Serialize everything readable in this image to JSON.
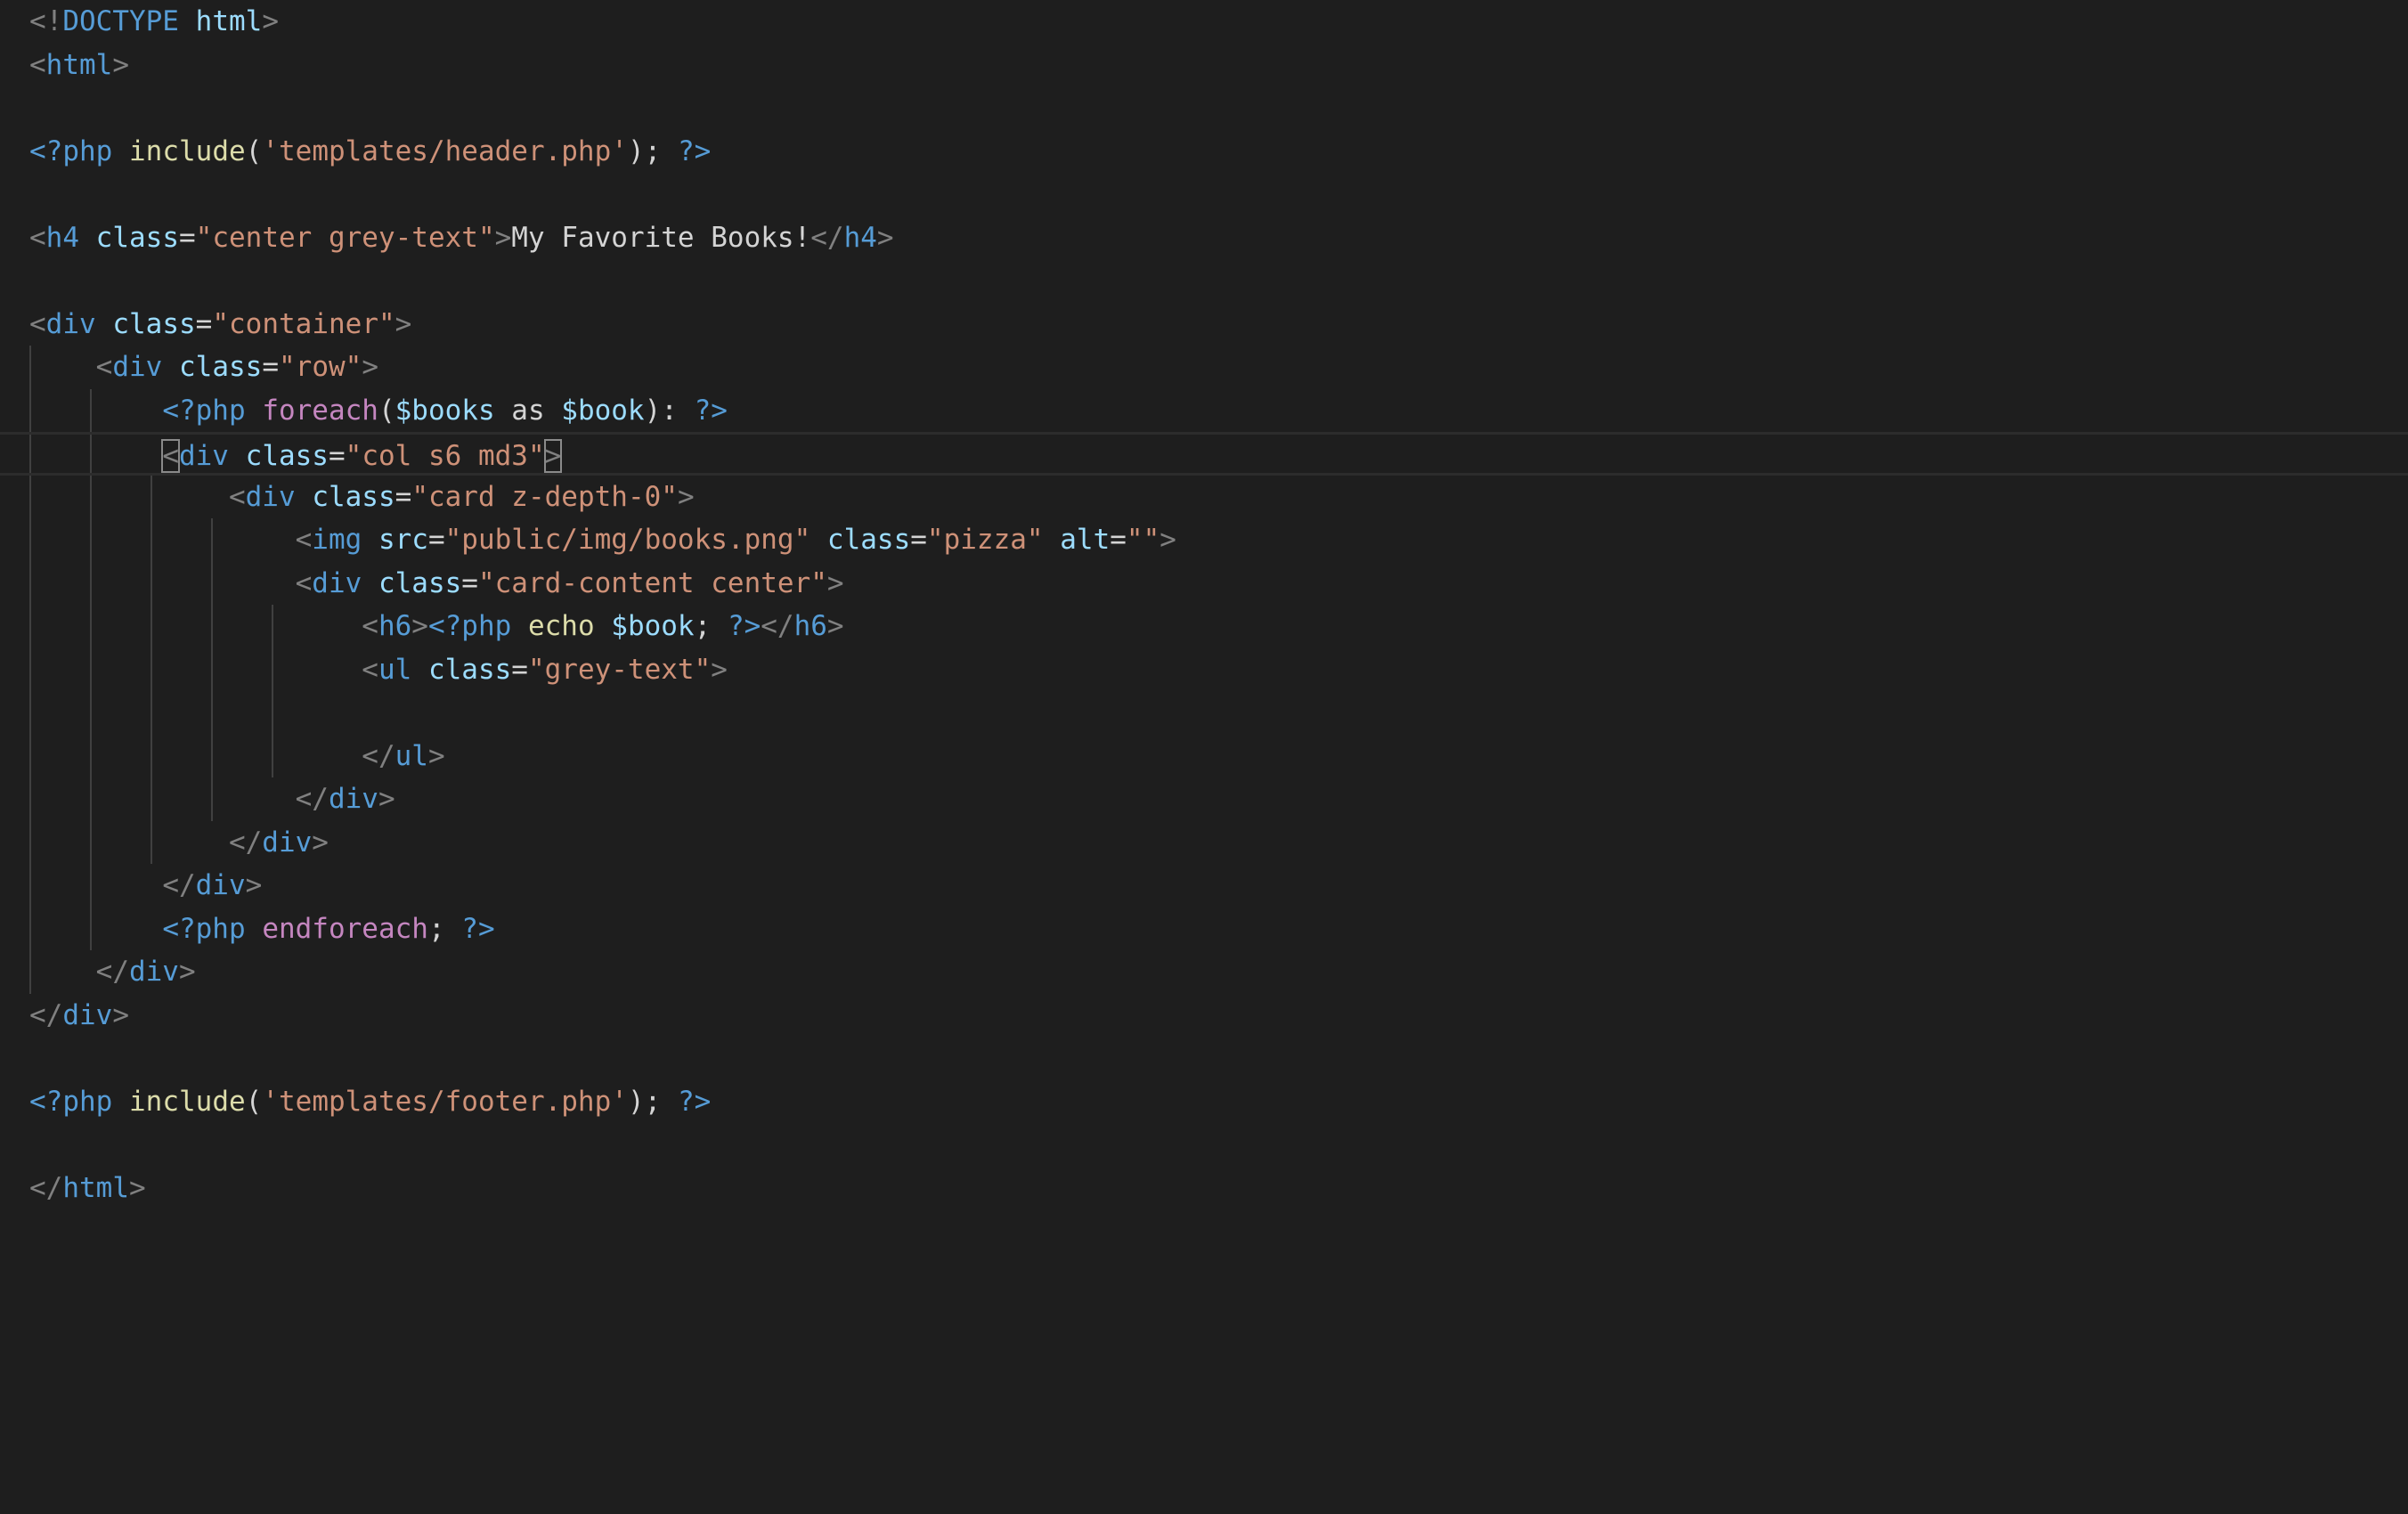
{
  "colors": {
    "background": "#1e1e1e",
    "punct": "#808080",
    "tag": "#569cd6",
    "attr": "#9cdcfe",
    "string": "#ce9178",
    "text": "#d4d4d4",
    "func": "#dcdcaa",
    "control": "#c586c0",
    "var": "#9cdcfe"
  },
  "current_line": 10,
  "lines": [
    {
      "indent": 0,
      "tokens": [
        {
          "t": "<!",
          "c": "punct"
        },
        {
          "t": "DOCTYPE",
          "c": "tag"
        },
        {
          "t": " ",
          "c": "text"
        },
        {
          "t": "html",
          "c": "attr"
        },
        {
          "t": ">",
          "c": "punct"
        }
      ]
    },
    {
      "indent": 0,
      "tokens": [
        {
          "t": "<",
          "c": "punct"
        },
        {
          "t": "html",
          "c": "tag"
        },
        {
          "t": ">",
          "c": "punct"
        }
      ]
    },
    {
      "indent": 0,
      "tokens": []
    },
    {
      "indent": 0,
      "tokens": [
        {
          "t": "<?php",
          "c": "tag"
        },
        {
          "t": " ",
          "c": "text"
        },
        {
          "t": "include",
          "c": "func"
        },
        {
          "t": "(",
          "c": "text"
        },
        {
          "t": "'templates/header.php'",
          "c": "string"
        },
        {
          "t": "); ",
          "c": "text"
        },
        {
          "t": "?>",
          "c": "tag"
        }
      ]
    },
    {
      "indent": 0,
      "tokens": []
    },
    {
      "indent": 0,
      "tokens": [
        {
          "t": "<",
          "c": "punct"
        },
        {
          "t": "h4",
          "c": "tag"
        },
        {
          "t": " ",
          "c": "text"
        },
        {
          "t": "class",
          "c": "attr"
        },
        {
          "t": "=",
          "c": "text"
        },
        {
          "t": "\"center grey-text\"",
          "c": "string"
        },
        {
          "t": ">",
          "c": "punct"
        },
        {
          "t": "My Favorite Books!",
          "c": "text"
        },
        {
          "t": "</",
          "c": "punct"
        },
        {
          "t": "h4",
          "c": "tag"
        },
        {
          "t": ">",
          "c": "punct"
        }
      ]
    },
    {
      "indent": 0,
      "tokens": []
    },
    {
      "indent": 0,
      "tokens": [
        {
          "t": "<",
          "c": "punct"
        },
        {
          "t": "div",
          "c": "tag"
        },
        {
          "t": " ",
          "c": "text"
        },
        {
          "t": "class",
          "c": "attr"
        },
        {
          "t": "=",
          "c": "text"
        },
        {
          "t": "\"container\"",
          "c": "string"
        },
        {
          "t": ">",
          "c": "punct"
        }
      ]
    },
    {
      "indent": 1,
      "tokens": [
        {
          "t": "<",
          "c": "punct"
        },
        {
          "t": "div",
          "c": "tag"
        },
        {
          "t": " ",
          "c": "text"
        },
        {
          "t": "class",
          "c": "attr"
        },
        {
          "t": "=",
          "c": "text"
        },
        {
          "t": "\"row\"",
          "c": "string"
        },
        {
          "t": ">",
          "c": "punct"
        }
      ]
    },
    {
      "indent": 2,
      "tokens": [
        {
          "t": "<?php",
          "c": "tag"
        },
        {
          "t": " ",
          "c": "text"
        },
        {
          "t": "foreach",
          "c": "control"
        },
        {
          "t": "(",
          "c": "text"
        },
        {
          "t": "$books",
          "c": "var"
        },
        {
          "t": " as ",
          "c": "text"
        },
        {
          "t": "$book",
          "c": "var"
        },
        {
          "t": "): ",
          "c": "text"
        },
        {
          "t": "?>",
          "c": "tag"
        }
      ]
    },
    {
      "indent": 2,
      "tokens": [
        {
          "t": "<",
          "c": "punct",
          "box": true
        },
        {
          "t": "div",
          "c": "tag"
        },
        {
          "t": " ",
          "c": "text"
        },
        {
          "t": "class",
          "c": "attr"
        },
        {
          "t": "=",
          "c": "text"
        },
        {
          "t": "\"col s6 md3\"",
          "c": "string"
        },
        {
          "t": ">",
          "c": "punct",
          "box": true
        }
      ]
    },
    {
      "indent": 3,
      "tokens": [
        {
          "t": "<",
          "c": "punct"
        },
        {
          "t": "div",
          "c": "tag"
        },
        {
          "t": " ",
          "c": "text"
        },
        {
          "t": "class",
          "c": "attr"
        },
        {
          "t": "=",
          "c": "text"
        },
        {
          "t": "\"card z-depth-0\"",
          "c": "string"
        },
        {
          "t": ">",
          "c": "punct"
        }
      ]
    },
    {
      "indent": 4,
      "tokens": [
        {
          "t": "<",
          "c": "punct"
        },
        {
          "t": "img",
          "c": "tag"
        },
        {
          "t": " ",
          "c": "text"
        },
        {
          "t": "src",
          "c": "attr"
        },
        {
          "t": "=",
          "c": "text"
        },
        {
          "t": "\"public/img/books.png\"",
          "c": "string"
        },
        {
          "t": " ",
          "c": "text"
        },
        {
          "t": "class",
          "c": "attr"
        },
        {
          "t": "=",
          "c": "text"
        },
        {
          "t": "\"pizza\"",
          "c": "string"
        },
        {
          "t": " ",
          "c": "text"
        },
        {
          "t": "alt",
          "c": "attr"
        },
        {
          "t": "=",
          "c": "text"
        },
        {
          "t": "\"\"",
          "c": "string"
        },
        {
          "t": ">",
          "c": "punct"
        }
      ]
    },
    {
      "indent": 4,
      "tokens": [
        {
          "t": "<",
          "c": "punct"
        },
        {
          "t": "div",
          "c": "tag"
        },
        {
          "t": " ",
          "c": "text"
        },
        {
          "t": "class",
          "c": "attr"
        },
        {
          "t": "=",
          "c": "text"
        },
        {
          "t": "\"card-content center\"",
          "c": "string"
        },
        {
          "t": ">",
          "c": "punct"
        }
      ]
    },
    {
      "indent": 5,
      "tokens": [
        {
          "t": "<",
          "c": "punct"
        },
        {
          "t": "h6",
          "c": "tag"
        },
        {
          "t": ">",
          "c": "punct"
        },
        {
          "t": "<?php",
          "c": "tag"
        },
        {
          "t": " ",
          "c": "text"
        },
        {
          "t": "echo",
          "c": "func"
        },
        {
          "t": " ",
          "c": "text"
        },
        {
          "t": "$book",
          "c": "var"
        },
        {
          "t": "; ",
          "c": "text"
        },
        {
          "t": "?>",
          "c": "tag"
        },
        {
          "t": "</",
          "c": "punct"
        },
        {
          "t": "h6",
          "c": "tag"
        },
        {
          "t": ">",
          "c": "punct"
        }
      ]
    },
    {
      "indent": 5,
      "tokens": [
        {
          "t": "<",
          "c": "punct"
        },
        {
          "t": "ul",
          "c": "tag"
        },
        {
          "t": " ",
          "c": "text"
        },
        {
          "t": "class",
          "c": "attr"
        },
        {
          "t": "=",
          "c": "text"
        },
        {
          "t": "\"grey-text\"",
          "c": "string"
        },
        {
          "t": ">",
          "c": "punct"
        }
      ]
    },
    {
      "indent": 5,
      "tokens": []
    },
    {
      "indent": 5,
      "tokens": [
        {
          "t": "</",
          "c": "punct"
        },
        {
          "t": "ul",
          "c": "tag"
        },
        {
          "t": ">",
          "c": "punct"
        }
      ]
    },
    {
      "indent": 4,
      "tokens": [
        {
          "t": "</",
          "c": "punct"
        },
        {
          "t": "div",
          "c": "tag"
        },
        {
          "t": ">",
          "c": "punct"
        }
      ]
    },
    {
      "indent": 3,
      "tokens": [
        {
          "t": "</",
          "c": "punct"
        },
        {
          "t": "div",
          "c": "tag"
        },
        {
          "t": ">",
          "c": "punct"
        }
      ]
    },
    {
      "indent": 2,
      "tokens": [
        {
          "t": "</",
          "c": "punct"
        },
        {
          "t": "div",
          "c": "tag"
        },
        {
          "t": ">",
          "c": "punct"
        }
      ]
    },
    {
      "indent": 2,
      "tokens": [
        {
          "t": "<?php",
          "c": "tag"
        },
        {
          "t": " ",
          "c": "text"
        },
        {
          "t": "endforeach",
          "c": "control"
        },
        {
          "t": "; ",
          "c": "text"
        },
        {
          "t": "?>",
          "c": "tag"
        }
      ]
    },
    {
      "indent": 1,
      "tokens": [
        {
          "t": "</",
          "c": "punct"
        },
        {
          "t": "div",
          "c": "tag"
        },
        {
          "t": ">",
          "c": "punct"
        }
      ]
    },
    {
      "indent": 0,
      "tokens": [
        {
          "t": "</",
          "c": "punct"
        },
        {
          "t": "div",
          "c": "tag"
        },
        {
          "t": ">",
          "c": "punct"
        }
      ]
    },
    {
      "indent": 0,
      "tokens": []
    },
    {
      "indent": 0,
      "tokens": [
        {
          "t": "<?php",
          "c": "tag"
        },
        {
          "t": " ",
          "c": "text"
        },
        {
          "t": "include",
          "c": "func"
        },
        {
          "t": "(",
          "c": "text"
        },
        {
          "t": "'templates/footer.php'",
          "c": "string"
        },
        {
          "t": "); ",
          "c": "text"
        },
        {
          "t": "?>",
          "c": "tag"
        }
      ]
    },
    {
      "indent": 0,
      "tokens": []
    },
    {
      "indent": 0,
      "tokens": [
        {
          "t": "</",
          "c": "punct"
        },
        {
          "t": "html",
          "c": "tag"
        },
        {
          "t": ">",
          "c": "punct"
        }
      ]
    }
  ]
}
